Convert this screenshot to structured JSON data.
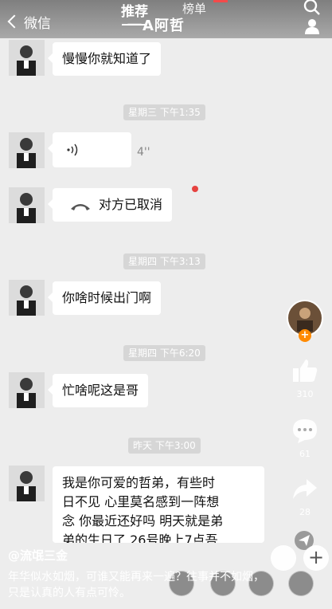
{
  "header": {
    "back_label": "微信",
    "tab_recommend": "推荐",
    "tab_rank": "榜单",
    "contact_name": "一A阿哲"
  },
  "messages": {
    "m1": "慢慢你就知道了",
    "t1": "星期三 下午1:35",
    "voice_duration": "4''",
    "call_text": "对方已取消",
    "t2": "星期四 下午3:13",
    "m2": "你啥时候出门啊",
    "t3": "星期四 下午6:20",
    "m3": "忙啥呢这是哥",
    "t4": "昨天 下午3:00",
    "m4_l1": "我是你可爱的哲弟，有些时",
    "m4_l2": "日不见 心里莫名感到一阵想",
    "m4_l3": "念 你最近还好吗 明天就是弟",
    "m4_l4": "弟的生日了 26号晚上7点吾"
  },
  "side": {
    "like_count": "310",
    "comment_count": "61",
    "share_count": "28"
  },
  "bottom": {
    "author": "@流氓三金",
    "caption": "年华似水如烟，可谁又能再来一遍？往事并不如烟，只是认真的人有点可怜。"
  },
  "colors": {
    "accent_red": "#f34a4a",
    "follow_orange": "#ff8a00",
    "chat_bg": "#ededed"
  }
}
